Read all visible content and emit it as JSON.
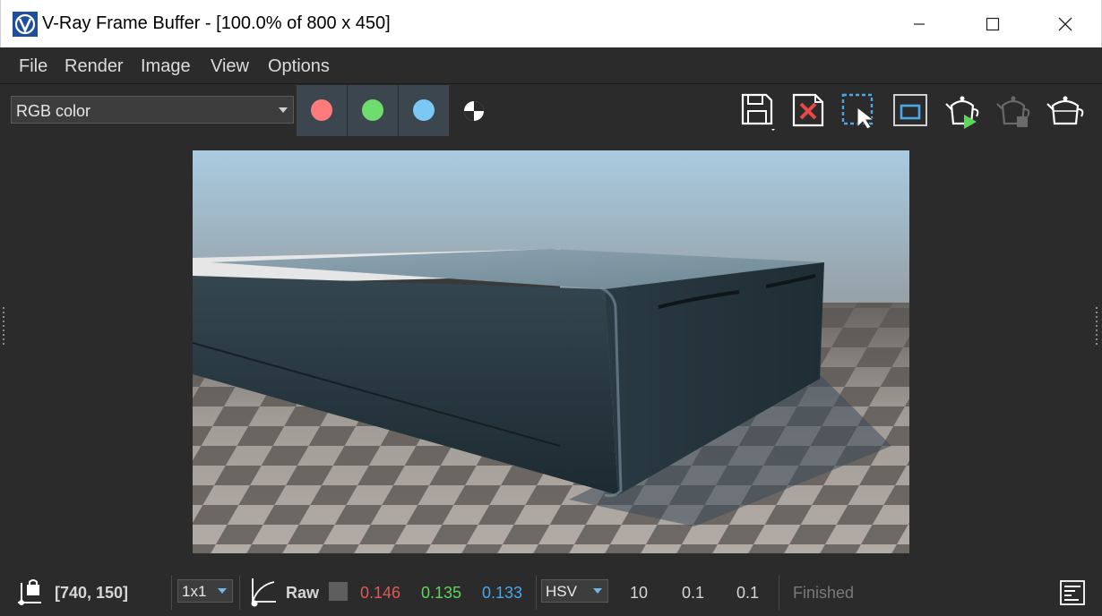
{
  "window": {
    "title": "V-Ray Frame Buffer - [100.0% of 800 x 450]",
    "app_icon": "vray-logo-icon",
    "controls": [
      "minimize-icon",
      "maximize-icon",
      "close-icon"
    ]
  },
  "menu": {
    "items": [
      "File",
      "Render",
      "Image",
      "View",
      "Options"
    ]
  },
  "toolbar": {
    "channel_select": "RGB color",
    "color_buttons": [
      {
        "name": "red-channel",
        "color": "#ff7b7b"
      },
      {
        "name": "green-channel",
        "color": "#6fdc6f"
      },
      {
        "name": "blue-channel",
        "color": "#7cc8f5"
      }
    ],
    "mono_icon": "alpha-channel-icon",
    "tools": [
      "save-image-icon",
      "clear-image-icon",
      "region-render-icon",
      "viewport-render-icon",
      "start-interactive-render-icon",
      "stop-render-icon",
      "render-teapot-icon"
    ]
  },
  "statusbar": {
    "coordinates": "[740, 150]",
    "sample_size": "1x1",
    "raw_label": "Raw",
    "r_value": "0.146",
    "g_value": "0.135",
    "b_value": "0.133",
    "color_mode": "HSV",
    "h_value": "10",
    "s_value": "0.1",
    "v_value": "0.1",
    "status": "Finished",
    "colors": {
      "r": "#e05858",
      "g": "#5cd65c",
      "b": "#4aa8e8"
    }
  }
}
